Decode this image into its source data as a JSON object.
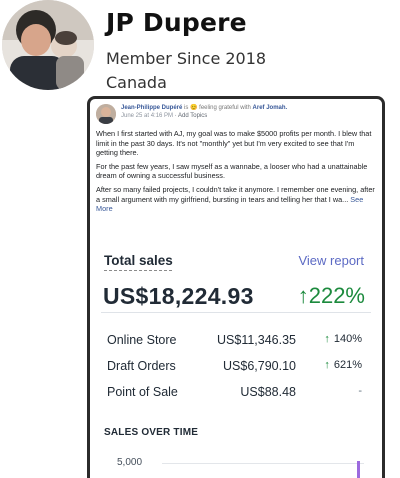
{
  "profile": {
    "name": "JP Dupere",
    "member_since": "Member Since 2018",
    "country": "Canada"
  },
  "post": {
    "author": "Jean-Philippe Dupéré",
    "feeling": "is 😊 feeling grateful with",
    "tagged": "Aref Jomah.",
    "date": "June 25 at 4:16 PM",
    "add_topics": "· Add Topics",
    "paragraphs": [
      "When I first started with AJ, my goal was to make $5000 profits per month. I blew that limit in the past 30 days. It's not \"monthly\" yet but I'm very excited to see that I'm getting there.",
      "For the past few years, I saw myself as a wannabe, a looser who had a unattainable dream of owning a successful business.",
      "After so many failed projects, I couldn't take it anymore. I remember one evening, after a small argument with my girlfriend, bursting in tears and telling her that I wa..."
    ],
    "see_more": "See More"
  },
  "sales": {
    "title": "Total sales",
    "view_report": "View report",
    "total": "US$18,224.93",
    "change": "↑222%",
    "rows": [
      {
        "label": "Online Store",
        "amount": "US$11,346.35",
        "change": "140%",
        "arrow": "↑"
      },
      {
        "label": "Draft Orders",
        "amount": "US$6,790.10",
        "change": "621%",
        "arrow": "↑"
      },
      {
        "label": "Point of Sale",
        "amount": "US$88.48",
        "change": "-",
        "arrow": ""
      }
    ],
    "over_time_label": "SALES OVER TIME",
    "axis_tick": "5,000"
  },
  "colors": {
    "link": "#5c6ac4",
    "positive": "#1c8a3d",
    "chart_spike": "#9c6ade"
  }
}
